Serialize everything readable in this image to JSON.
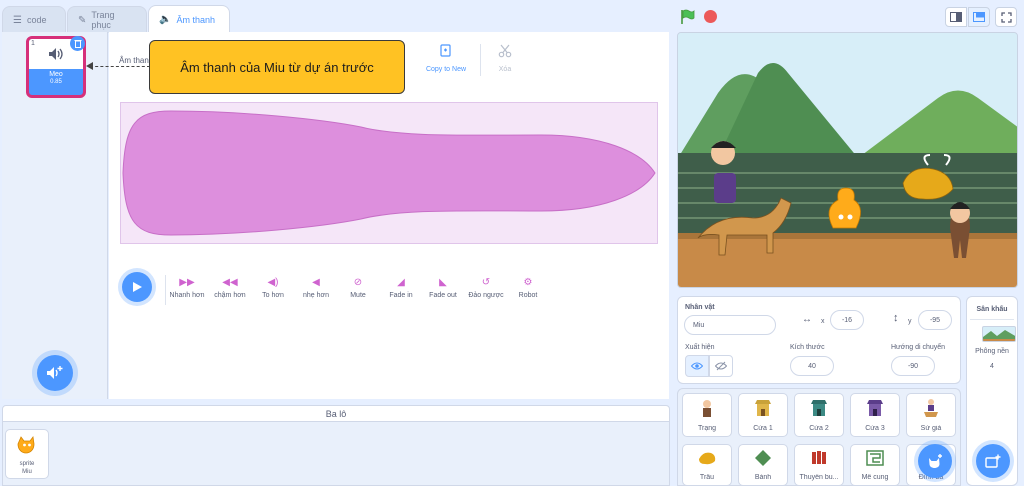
{
  "tabs": [
    {
      "label": "code",
      "icon": "code-icon"
    },
    {
      "label": "Trang phục",
      "icon": "brush-icon"
    },
    {
      "label": "Âm thanh",
      "icon": "speaker-icon",
      "active": true
    }
  ],
  "sound_list": [
    {
      "index": "1",
      "name": "Meo",
      "duration": "0.85",
      "selected": true
    }
  ],
  "editor": {
    "sound_label_fragment": "Âm than",
    "copy_to_new": "Copy to New",
    "delete": "Xóa",
    "effects": [
      {
        "label": "Nhanh hơn",
        "icon": "faster-icon"
      },
      {
        "label": "chậm hơn",
        "icon": "slower-icon"
      },
      {
        "label": "To hơn",
        "icon": "louder-icon"
      },
      {
        "label": "nhẹ hơn",
        "icon": "softer-icon"
      },
      {
        "label": "Mute",
        "icon": "mute-icon"
      },
      {
        "label": "Fade in",
        "icon": "fade-in-icon"
      },
      {
        "label": "Fade out",
        "icon": "fade-out-icon"
      },
      {
        "label": "Đảo ngược",
        "icon": "reverse-icon"
      },
      {
        "label": "Robot",
        "icon": "robot-icon"
      }
    ]
  },
  "callout": {
    "text": "Âm thanh của Miu từ dự án trước"
  },
  "backpack": {
    "title": "Ba lô",
    "items": [
      {
        "label_line1": "sprite",
        "label_line2": "Miu"
      }
    ]
  },
  "sprite_info": {
    "sprite_label": "Nhân vật",
    "sprite_name": "Miu",
    "x_label": "x",
    "x_value": "-16",
    "y_label": "y",
    "y_value": "-95",
    "show_label": "Xuất hiện",
    "size_label": "Kích thước",
    "size_value": "40",
    "direction_label": "Hướng di chuyển",
    "direction_value": "-90"
  },
  "sprites": [
    {
      "label": "Trạng"
    },
    {
      "label": "Cửa 1"
    },
    {
      "label": "Cửa 2"
    },
    {
      "label": "Cửa 3"
    },
    {
      "label": "Sứ giả"
    },
    {
      "label": "Trâu"
    },
    {
      "label": "Bánh"
    },
    {
      "label": "Thuyền bu..."
    },
    {
      "label": "Mê cung"
    },
    {
      "label": "Đình ba"
    }
  ],
  "stage_panel": {
    "title": "Sân khấu",
    "backdrops_label": "Phông nền",
    "backdrops_count": "4"
  },
  "colors": {
    "accent": "#4c97ff",
    "sound_tile_border": "#d6307a",
    "waveform": "#dd8fdd",
    "effect_icon": "#cf63cf",
    "callout": "#ffc223"
  }
}
